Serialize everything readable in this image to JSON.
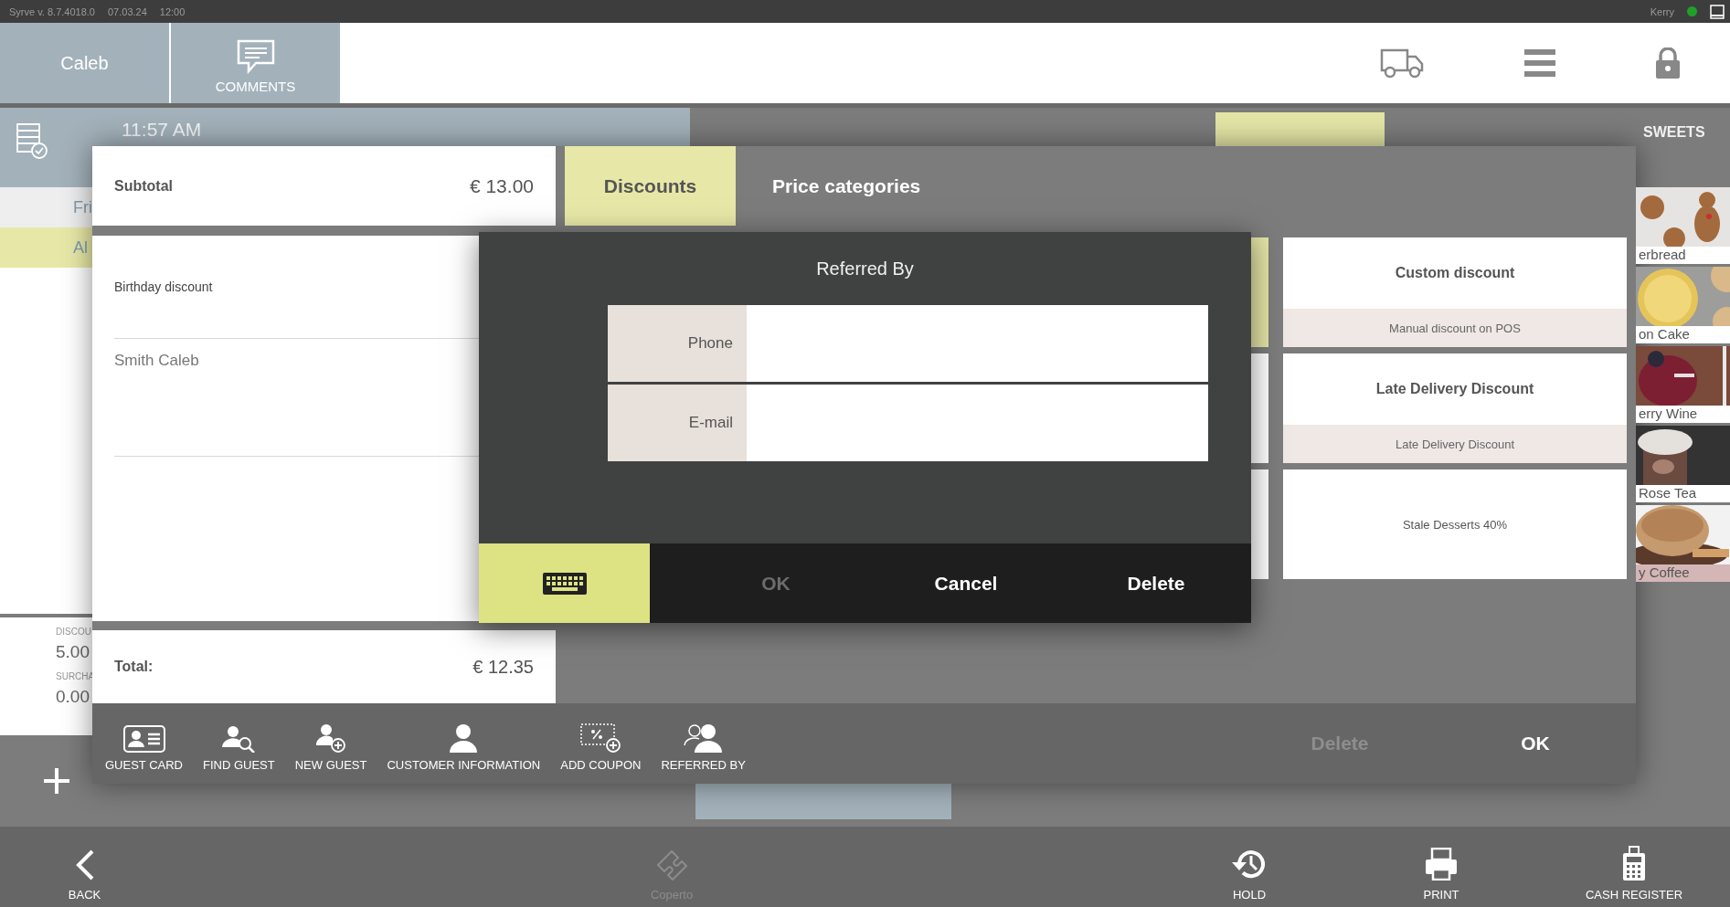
{
  "status_bar": {
    "version": "Syrve  v. 8.7.4018.0",
    "date": "07.03.24",
    "time": "12:00",
    "user": "Kerry",
    "online": true
  },
  "header": {
    "guest_tab": "Caleb",
    "comments_button": "COMMENTS"
  },
  "order_panel": {
    "time": "11:57 AM",
    "rows": [
      {
        "text": "Fri",
        "selected": false
      },
      {
        "text": "Al",
        "selected": true
      }
    ],
    "summary": [
      {
        "label": "DISCOU",
        "value": "5.00"
      },
      {
        "label": "SURCHA",
        "value": "0.00"
      }
    ]
  },
  "category_tabs": [
    {
      "selected": true
    }
  ],
  "category_heading": "SWEETS",
  "products": [
    {
      "name": "erbread",
      "selected": false
    },
    {
      "name": "on Cake",
      "selected": false
    },
    {
      "name": "erry Wine",
      "selected": false
    },
    {
      "name": "Rose Tea",
      "selected": false
    },
    {
      "name": "y Coffee",
      "selected": true
    }
  ],
  "discount_dialog": {
    "subtotal_label": "Subtotal",
    "subtotal": "€ 13.00",
    "applied": [
      {
        "text": "Birthday discount",
        "kind": "discount"
      },
      {
        "text": "Smith Caleb",
        "kind": "guest"
      }
    ],
    "total_label": "Total:",
    "total": "€ 12.35",
    "tabs": [
      {
        "label": "Discounts",
        "selected": true
      },
      {
        "label": "Price categories",
        "selected": false
      }
    ],
    "hidden_tiles": [
      {
        "selected": true
      },
      {
        "selected": false
      },
      {
        "selected": false
      }
    ],
    "discounts": [
      {
        "title": "Custom discount",
        "subtitle": "Manual discount on POS"
      },
      {
        "title": "Late Delivery Discount",
        "subtitle": "Late Delivery Discount"
      },
      {
        "title": "Stale Desserts 40%"
      }
    ],
    "tools": [
      {
        "label": "GUEST CARD",
        "kind": "guest-card"
      },
      {
        "label": "FIND GUEST",
        "kind": "find-guest"
      },
      {
        "label": "NEW GUEST",
        "kind": "new-guest"
      },
      {
        "label": "CUSTOMER INFORMATION",
        "kind": "customer"
      },
      {
        "label": "ADD COUPON",
        "kind": "coupon"
      },
      {
        "label": "REFERRED BY",
        "kind": "referred"
      }
    ],
    "delete_button": {
      "label": "Delete",
      "disabled": true
    },
    "ok_button": {
      "label": "OK",
      "disabled": false
    }
  },
  "referred_popup": {
    "title": "Referred By",
    "fields": [
      {
        "label": "Phone"
      },
      {
        "label": "E-mail"
      }
    ],
    "buttons": [
      {
        "label": "OK",
        "disabled": true
      },
      {
        "label": "Cancel",
        "disabled": false
      },
      {
        "label": "Delete",
        "disabled": false
      }
    ]
  },
  "bottom_bar": [
    {
      "label": "BACK",
      "kind": "back",
      "disabled": false
    },
    {
      "label": "Coperto",
      "kind": "coperto",
      "disabled": true
    },
    {
      "label": "HOLD",
      "kind": "hold",
      "disabled": false
    },
    {
      "label": "PRINT",
      "kind": "print",
      "disabled": false
    },
    {
      "label": "CASH REGISTER",
      "kind": "cash-register",
      "disabled": false
    }
  ]
}
